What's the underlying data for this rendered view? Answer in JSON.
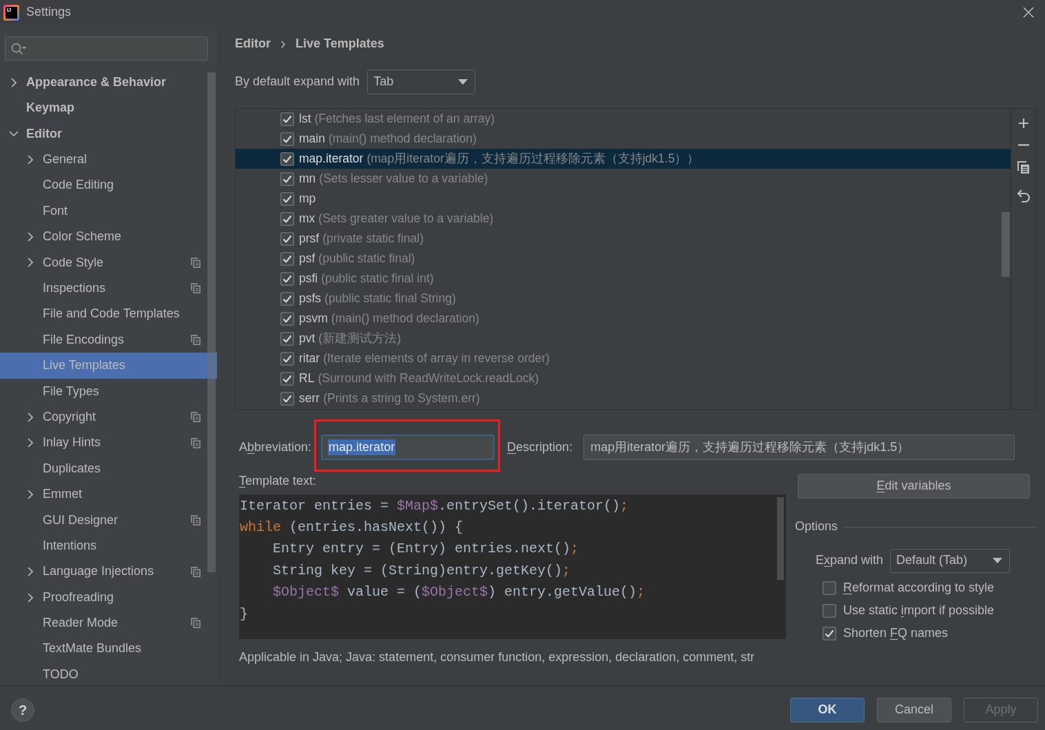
{
  "window": {
    "title": "Settings",
    "logo_text": "IJ"
  },
  "sidebar": {
    "items": [
      {
        "label": "Appearance & Behavior",
        "kind": "branch",
        "expanded": false,
        "selected": false,
        "per_project": false
      },
      {
        "label": "Keymap",
        "kind": "leaf",
        "selected": false,
        "per_project": false
      },
      {
        "label": "Editor",
        "kind": "branch",
        "expanded": true,
        "selected": false,
        "per_project": false,
        "children": [
          {
            "label": "General",
            "kind": "branch",
            "expanded": false,
            "selected": false,
            "per_project": false
          },
          {
            "label": "Code Editing",
            "kind": "leaf",
            "selected": false,
            "per_project": false
          },
          {
            "label": "Font",
            "kind": "leaf",
            "selected": false,
            "per_project": false
          },
          {
            "label": "Color Scheme",
            "kind": "branch",
            "expanded": false,
            "selected": false,
            "per_project": false
          },
          {
            "label": "Code Style",
            "kind": "branch",
            "expanded": false,
            "selected": false,
            "per_project": true
          },
          {
            "label": "Inspections",
            "kind": "leaf",
            "selected": false,
            "per_project": true
          },
          {
            "label": "File and Code Templates",
            "kind": "leaf",
            "selected": false,
            "per_project": false
          },
          {
            "label": "File Encodings",
            "kind": "leaf",
            "selected": false,
            "per_project": true
          },
          {
            "label": "Live Templates",
            "kind": "leaf",
            "selected": true,
            "per_project": false
          },
          {
            "label": "File Types",
            "kind": "leaf",
            "selected": false,
            "per_project": false
          },
          {
            "label": "Copyright",
            "kind": "branch",
            "expanded": false,
            "selected": false,
            "per_project": true
          },
          {
            "label": "Inlay Hints",
            "kind": "branch",
            "expanded": false,
            "selected": false,
            "per_project": true
          },
          {
            "label": "Duplicates",
            "kind": "leaf",
            "selected": false,
            "per_project": false
          },
          {
            "label": "Emmet",
            "kind": "branch",
            "expanded": false,
            "selected": false,
            "per_project": false
          },
          {
            "label": "GUI Designer",
            "kind": "leaf",
            "selected": false,
            "per_project": true
          },
          {
            "label": "Intentions",
            "kind": "leaf",
            "selected": false,
            "per_project": false
          },
          {
            "label": "Language Injections",
            "kind": "branch",
            "expanded": false,
            "selected": false,
            "per_project": true
          },
          {
            "label": "Proofreading",
            "kind": "branch",
            "expanded": false,
            "selected": false,
            "per_project": false
          },
          {
            "label": "Reader Mode",
            "kind": "leaf",
            "selected": false,
            "per_project": true
          },
          {
            "label": "TextMate Bundles",
            "kind": "leaf",
            "selected": false,
            "per_project": false
          },
          {
            "label": "TODO",
            "kind": "leaf",
            "selected": false,
            "per_project": false
          }
        ]
      }
    ]
  },
  "breadcrumb": [
    "Editor",
    "Live Templates"
  ],
  "default_expand": {
    "label": "By default expand with",
    "value": "Tab"
  },
  "templates": [
    {
      "abbreviation": "lst",
      "description": "(Fetches last element of an array)",
      "checked": true,
      "selected": false
    },
    {
      "abbreviation": "main",
      "description": "(main() method declaration)",
      "checked": true,
      "selected": false
    },
    {
      "abbreviation": "map.iterator",
      "description": "(map用iterator遍历，支持遍历过程移除元素（支持jdk1.5））",
      "checked": true,
      "selected": true
    },
    {
      "abbreviation": "mn",
      "description": "(Sets lesser value to a variable)",
      "checked": true,
      "selected": false
    },
    {
      "abbreviation": "mp",
      "checked": true,
      "selected": false
    },
    {
      "abbreviation": "mx",
      "description": "(Sets greater value to a variable)",
      "checked": true,
      "selected": false
    },
    {
      "abbreviation": "prsf",
      "description": "(private static final)",
      "checked": true,
      "selected": false
    },
    {
      "abbreviation": "psf",
      "description": "(public static final)",
      "checked": true,
      "selected": false
    },
    {
      "abbreviation": "psfi",
      "description": "(public static final int)",
      "checked": true,
      "selected": false
    },
    {
      "abbreviation": "psfs",
      "description": "(public static final String)",
      "checked": true,
      "selected": false
    },
    {
      "abbreviation": "psvm",
      "description": "(main() method declaration)",
      "checked": true,
      "selected": false
    },
    {
      "abbreviation": "pvt",
      "description": "(新建测试方法)",
      "checked": true,
      "selected": false
    },
    {
      "abbreviation": "ritar",
      "description": "(Iterate elements of array in reverse order)",
      "checked": true,
      "selected": false
    },
    {
      "abbreviation": "RL",
      "description": "(Surround with ReadWriteLock.readLock)",
      "checked": true,
      "selected": false
    },
    {
      "abbreviation": "serr",
      "description": "(Prints a string to System.err)",
      "checked": true,
      "selected": false
    }
  ],
  "abbreviation": {
    "label": {
      "pre": "A",
      "key": "b",
      "post": "breviation:"
    },
    "value": "map.iterator",
    "text_selected": true,
    "highlighted": true
  },
  "description": {
    "label": {
      "key": "D",
      "post": "escription:"
    },
    "value": "map用iterator遍历，支持遍历过程移除元素（支持jdk1.5）"
  },
  "template_text": {
    "label": {
      "key": "T",
      "post": "emplate text:"
    },
    "lines": [
      [
        {
          "kind": "plain",
          "text": "Iterator entries = "
        },
        {
          "kind": "variable",
          "text": "$Map$"
        },
        {
          "kind": "plain",
          "text": ".entrySet().iterator()"
        },
        {
          "kind": "punct",
          "text": ";"
        }
      ],
      [
        {
          "kind": "keyword",
          "text": "while"
        },
        {
          "kind": "plain",
          "text": " (entries.hasNext()) {"
        }
      ],
      [
        {
          "kind": "plain",
          "text": "    Entry entry = (Entry) entries.next()"
        },
        {
          "kind": "punct",
          "text": ";"
        }
      ],
      [
        {
          "kind": "plain",
          "text": "    String key = (String)entry.getKey()"
        },
        {
          "kind": "punct",
          "text": ";"
        }
      ],
      [
        {
          "kind": "variable",
          "text": "    $Object$"
        },
        {
          "kind": "plain",
          "text": " value = ("
        },
        {
          "kind": "variable",
          "text": "$Object$"
        },
        {
          "kind": "plain",
          "text": ") entry.getValue()"
        },
        {
          "kind": "punct",
          "text": ";"
        }
      ],
      [
        {
          "kind": "plain",
          "text": "}"
        }
      ]
    ]
  },
  "applicable": "Applicable in Java; Java: statement, consumer function, expression, declaration, comment, str",
  "edit_variables": {
    "label": {
      "key": "E",
      "post": "dit variables"
    }
  },
  "options": {
    "title": "Options",
    "expand_with": {
      "label": {
        "pre": "E",
        "key": "x",
        "post": "pand with"
      },
      "value": "Default (Tab)"
    },
    "checkboxes": [
      {
        "label": {
          "key": "R",
          "post": "eformat according to style"
        },
        "checked": false
      },
      {
        "label": {
          "pre": "Use static ",
          "key": "i",
          "post": "mport if possible"
        },
        "checked": false
      },
      {
        "label": {
          "pre": "Shorten ",
          "key": "F",
          "post": "Q names"
        },
        "checked": true
      }
    ]
  },
  "footer": {
    "help": "?",
    "buttons": [
      {
        "label": "OK",
        "kind": "primary",
        "disabled": false
      },
      {
        "label": "Cancel",
        "kind": "secondary",
        "disabled": false
      },
      {
        "label": "Apply",
        "kind": "secondary",
        "disabled": true
      }
    ]
  }
}
